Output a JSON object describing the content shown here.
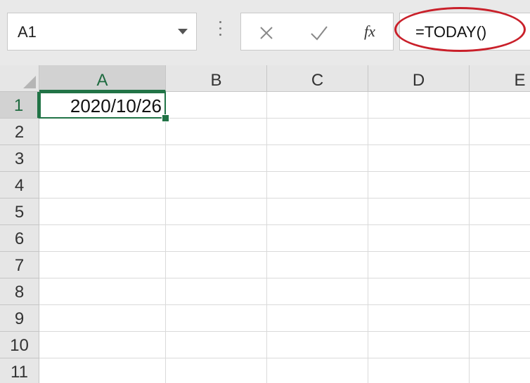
{
  "name_box": {
    "value": "A1"
  },
  "formula_bar": {
    "cancel_icon": "close-icon",
    "enter_icon": "check-icon",
    "fx_label": "fx",
    "formula": "=TODAY()",
    "highlight_color": "#c9202a"
  },
  "grid": {
    "columns": [
      "A",
      "B",
      "C",
      "D",
      "E"
    ],
    "rows": [
      "1",
      "2",
      "3",
      "4",
      "5",
      "6",
      "7",
      "8",
      "9",
      "10",
      "11"
    ],
    "active_cell": {
      "column": "A",
      "row": "1",
      "value": "2020/10/26"
    },
    "accent_color": "#217346"
  }
}
